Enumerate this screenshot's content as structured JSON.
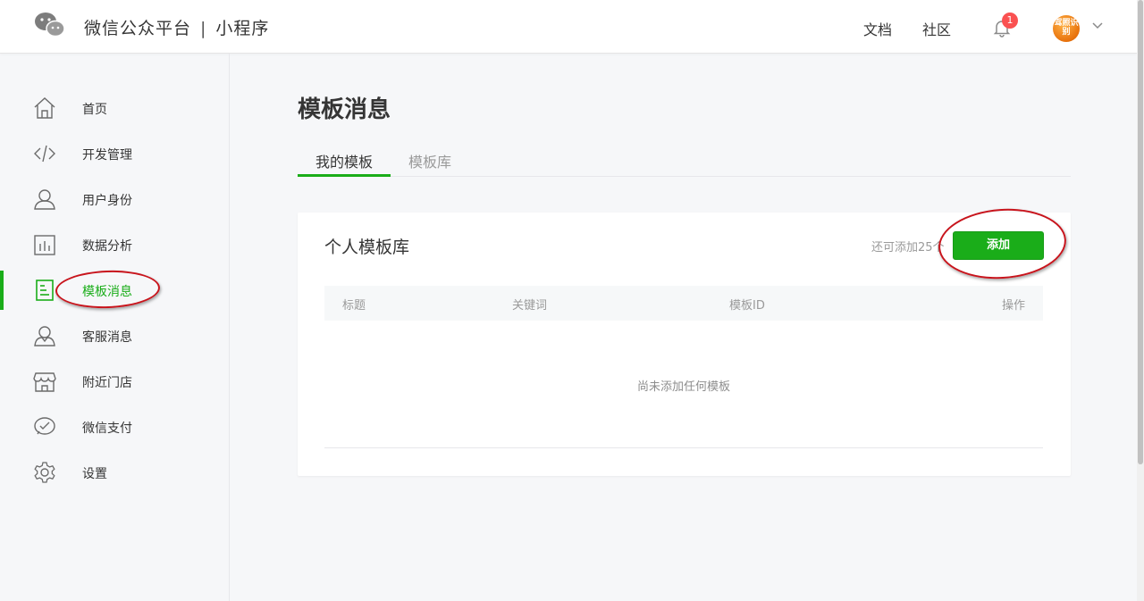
{
  "header": {
    "brand": "微信公众平台",
    "separator": "|",
    "product": "小程序",
    "links": {
      "docs": "文档",
      "community": "社区"
    },
    "notification_count": "1",
    "avatar_text": "驾照识别"
  },
  "sidebar": {
    "items": [
      {
        "label": "首页",
        "icon": "home-icon"
      },
      {
        "label": "开发管理",
        "icon": "code-icon"
      },
      {
        "label": "用户身份",
        "icon": "user-icon"
      },
      {
        "label": "数据分析",
        "icon": "chart-icon"
      },
      {
        "label": "模板消息",
        "icon": "template-icon",
        "active": true
      },
      {
        "label": "客服消息",
        "icon": "service-icon"
      },
      {
        "label": "附近门店",
        "icon": "store-icon"
      },
      {
        "label": "微信支付",
        "icon": "pay-icon"
      },
      {
        "label": "设置",
        "icon": "gear-icon"
      }
    ]
  },
  "main": {
    "title": "模板消息",
    "tabs": [
      {
        "label": "我的模板",
        "active": true
      },
      {
        "label": "模板库",
        "active": false
      }
    ],
    "card": {
      "title": "个人模板库",
      "hint": "还可添加25个",
      "add_button": "添加",
      "columns": [
        "标题",
        "关键词",
        "模板ID",
        "操作"
      ],
      "empty_text": "尚未添加任何模板"
    }
  },
  "colors": {
    "accent": "#1aad19",
    "annotation": "#c8141c",
    "badge": "#fa5151"
  }
}
